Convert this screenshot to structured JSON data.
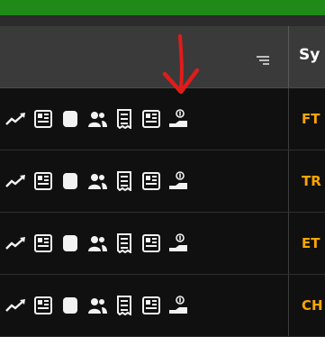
{
  "table": {
    "header": {
      "symbol_label": "Sy"
    },
    "rows": [
      {
        "symbol": "FT"
      },
      {
        "symbol": "TR"
      },
      {
        "symbol": "ET"
      },
      {
        "symbol": "CH"
      }
    ],
    "row_actions": [
      "trend-icon",
      "news-icon",
      "database-icon",
      "holders-icon",
      "receipt-icon",
      "report-icon",
      "dividend-icon"
    ]
  },
  "colors": {
    "accent_bar": "#1f8a17",
    "symbol_text": "#ffa500",
    "annotation_arrow": "#e11b1b"
  }
}
